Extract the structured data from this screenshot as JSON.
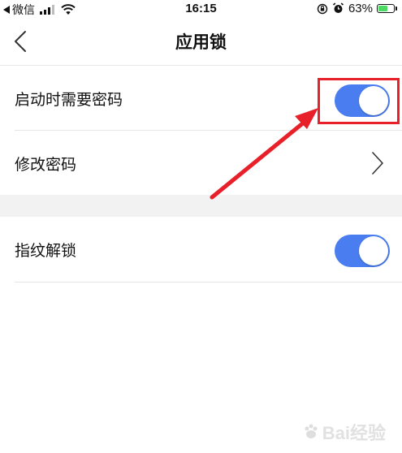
{
  "status_bar": {
    "carrier": "微信",
    "time": "16:15",
    "battery": "63%",
    "battery_level": 0.63
  },
  "nav": {
    "title": "应用锁"
  },
  "settings": {
    "items": [
      {
        "label": "启动时需要密码",
        "toggle_on": true
      },
      {
        "label": "修改密码"
      },
      {
        "label": "指纹解锁",
        "toggle_on": true
      }
    ]
  },
  "colors": {
    "toggle_on": "#4a7ef0",
    "annotation": "#e8202a",
    "section_gap": "#f2f2f2"
  },
  "watermark": {
    "text": "Bai经验"
  }
}
